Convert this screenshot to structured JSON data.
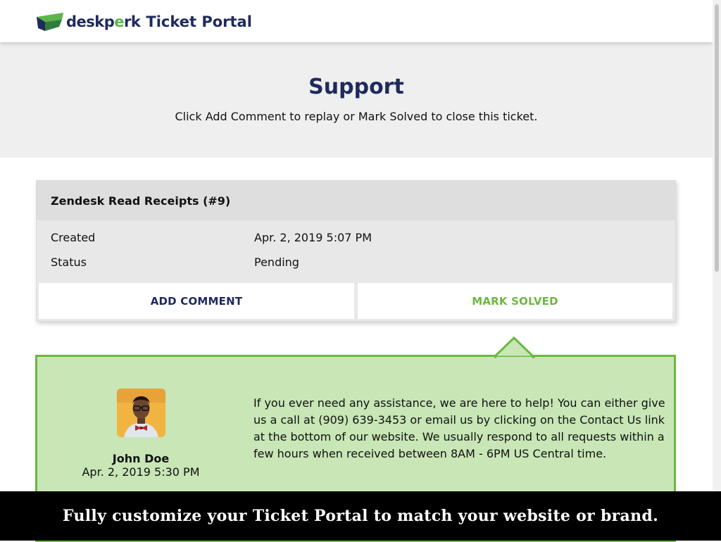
{
  "header": {
    "logo_text_prefix": "desk",
    "logo_text_p": "p",
    "logo_text_e": "e",
    "logo_text_suffix": "rk",
    "portal_name": "Ticket Portal",
    "logo_icon": "deskperk-logo-icon"
  },
  "hero": {
    "title": "Support",
    "subtitle": "Click Add Comment to replay or Mark Solved to close this ticket."
  },
  "ticket": {
    "title": "Zendesk Read Receipts (#9)",
    "fields": [
      {
        "label": "Created",
        "value": "Apr. 2, 2019 5:07 PM"
      },
      {
        "label": "Status",
        "value": "Pending"
      }
    ],
    "add_comment_label": "ADD COMMENT",
    "mark_solved_label": "MARK SOLVED"
  },
  "comment": {
    "author": "John Doe",
    "date": "Apr. 2, 2019 5:30 PM",
    "avatar_icon": "user-avatar",
    "body": "If you ever need any assistance, we are here to help!  You can either give us a call at (909) 639-3453 or email us by clicking on the Contact Us link at the bottom of our website.  We usually respond to all requests within a few hours when received between 8AM - 6PM US Central time."
  },
  "banner": {
    "text": "Fully customize your Ticket Portal to match your website or brand."
  },
  "colors": {
    "brand_navy": "#1f2a5c",
    "brand_green": "#6cb83f",
    "comment_bg": "#c8e6b6",
    "hero_bg": "#efefef"
  }
}
